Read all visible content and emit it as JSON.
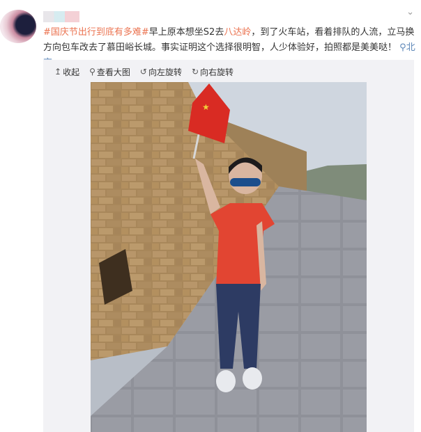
{
  "post": {
    "hashtag": "#国庆节出行到底有多难#",
    "text_a": "早上原本想坐S2去",
    "place_link": "八达岭",
    "text_b": "，到了火车站，看着排队的人流，立马换方向包车改去了慕田峪长城。事实证明这个选择很明智，人少体验好，拍照都是美美哒！",
    "location": "北京",
    "more_icon": "chevron-down-icon"
  },
  "toolbar": {
    "collapse": "收起",
    "view_large": "查看大图",
    "rotate_left": "向左旋转",
    "rotate_right": "向右旋转"
  },
  "photo": {
    "subject": "girl holding Chinese flag on the Great Wall",
    "colors": {
      "sky": "#c9d1db",
      "wall": "#b08d5e",
      "shirt": "#e24532",
      "flag": "#d92b23"
    }
  }
}
